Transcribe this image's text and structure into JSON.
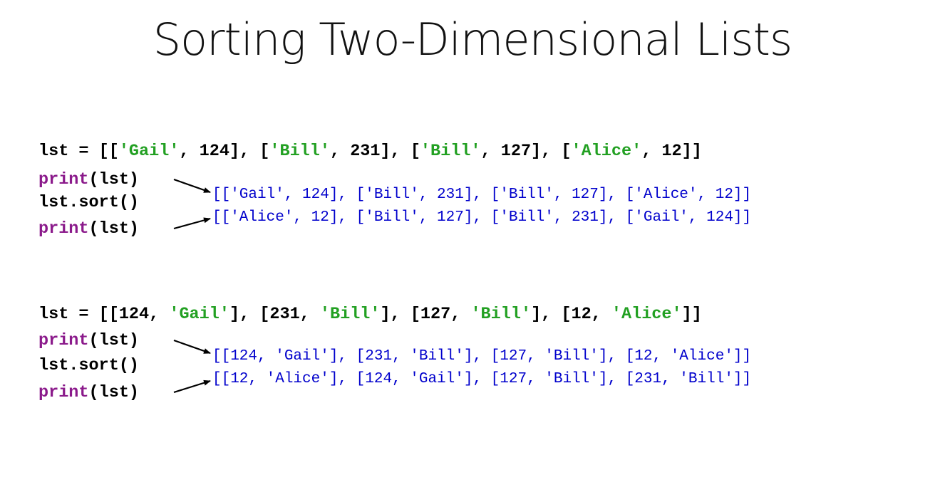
{
  "title": "Sorting Two-Dimensional Lists",
  "colors": {
    "keyword": "#8b1a8b",
    "plain": "#000000",
    "string": "#22a022",
    "output": "#0000cc"
  },
  "block1": {
    "assign": {
      "prefix": "lst = [[",
      "s1": "'Gail'",
      "t1": ", 124], [",
      "s2": "'Bill'",
      "t2": ", 231], [",
      "s3": "'Bill'",
      "t3": ", 127], [",
      "s4": "'Alice'",
      "t4": ", 12]]"
    },
    "print_kw": "print",
    "print_arg": "(lst)",
    "sort_call": "lst.sort()",
    "output_before": "[['Gail', 124], ['Bill', 231], ['Bill', 127], ['Alice', 12]]",
    "output_after": "[['Alice', 12], ['Bill', 127], ['Bill', 231], ['Gail', 124]]"
  },
  "block2": {
    "assign": {
      "prefix": "lst = [[124, ",
      "s1": "'Gail'",
      "t1": "], [231, ",
      "s2": "'Bill'",
      "t2": "], [127, ",
      "s3": "'Bill'",
      "t3": "], [12, ",
      "s4": "'Alice'",
      "t4": "]]"
    },
    "print_kw": "print",
    "print_arg": "(lst)",
    "sort_call": "lst.sort()",
    "output_before": "[[124, 'Gail'], [231, 'Bill'], [127, 'Bill'], [12, 'Alice']]",
    "output_after": "[[12, 'Alice'], [124, 'Gail'], [127, 'Bill'], [231, 'Bill']]"
  }
}
